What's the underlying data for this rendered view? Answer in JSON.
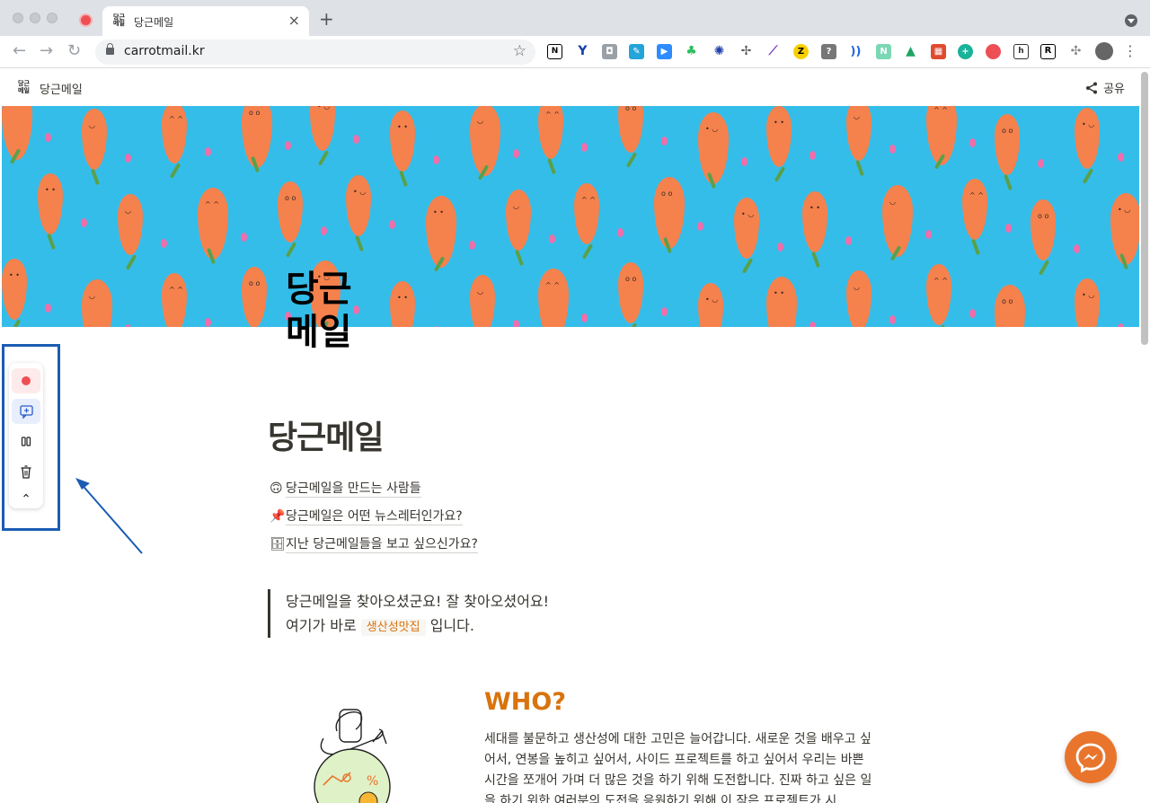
{
  "browser": {
    "tab_title": "당근메일",
    "tab_favicon_text": "당근\n메일",
    "url": "carrotmail.kr"
  },
  "site": {
    "name": "당근메일",
    "share_label": "공유"
  },
  "cover": {
    "page_icon_line1": "당근",
    "page_icon_line2": "메일"
  },
  "page": {
    "title": "당근메일",
    "links": [
      {
        "emoji": "🙃",
        "label": "당근메일을 만드는 사람들"
      },
      {
        "emoji": "📌",
        "label": "당근메일은 어떤 뉴스레터인가요?"
      },
      {
        "emoji": "🗄",
        "label": "지난 당근메일들을 보고 싶으신가요?"
      }
    ],
    "quote_line1": "당근메일을 찾아오셨군요! 잘 찾아오셨어요!",
    "quote_line2_prefix": "여기가 바로",
    "quote_code": "생산성맛집",
    "quote_line2_suffix": "입니다.",
    "who_heading": "WHO?",
    "who_body": "세대를 불문하고 생산성에 대한 고민은 늘어갑니다. 새로운 것을 배우고 싶어서, 연봉을 높히고 싶어서, 사이드 프로젝트를 하고 싶어서 우리는 바쁜 시간을 쪼개어 가며 더 많은 것을 하기 위해 도전합니다. 진짜 하고 싶은 일을 하기 위한 여러분의 도전을 응원하기 위해 이 작은 프로젝트가 시"
  },
  "colors": {
    "cover_bg": "#35bde9",
    "carrot": "#f5814d",
    "accent_orange": "#d9730d",
    "annotation_blue": "#1a5cb3",
    "record_red": "#ee4f55"
  },
  "icons": [
    "lock-icon",
    "star-icon",
    "share-icon",
    "record-icon",
    "add-comment-icon",
    "pause-icon",
    "trash-icon",
    "chevron-up-icon",
    "messenger-icon"
  ]
}
